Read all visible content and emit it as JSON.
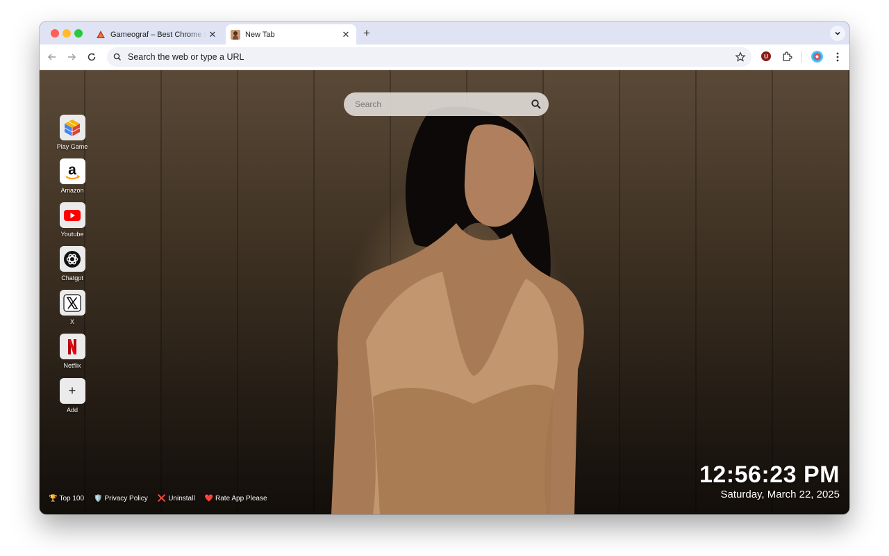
{
  "browser": {
    "tabs": [
      {
        "title": "Gameograf – Best Chrome Li…",
        "active": false,
        "favicon": "gameograf-logo-icon"
      },
      {
        "title": "New Tab",
        "active": true,
        "favicon": "portrait-favicon-icon"
      }
    ],
    "omnibox_placeholder": "Search the web or type a URL",
    "extensions": [
      {
        "name": "ublock-origin-icon",
        "glyph": "U",
        "color": "#8b1a1a"
      },
      {
        "name": "extensions-puzzle-icon"
      }
    ]
  },
  "newtab": {
    "search_placeholder": "Search",
    "shortcuts": [
      {
        "label": "Play Game",
        "icon": "cube-game-icon"
      },
      {
        "label": "Amazon",
        "icon": "amazon-icon"
      },
      {
        "label": "Youtube",
        "icon": "youtube-icon"
      },
      {
        "label": "Chatgpt",
        "icon": "chatgpt-icon"
      },
      {
        "label": "X",
        "icon": "x-logo-icon"
      },
      {
        "label": "Netflix",
        "icon": "netflix-icon"
      },
      {
        "label": "Add",
        "icon": "plus-icon"
      }
    ],
    "footer_links": [
      {
        "icon": "🏆",
        "label": "Top 100"
      },
      {
        "icon": "🛡️",
        "label": "Privacy Policy"
      },
      {
        "icon": "❌",
        "label": "Uninstall"
      },
      {
        "icon": "❤️",
        "label": "Rate App Please"
      }
    ],
    "clock": {
      "time": "12:56:23 PM",
      "date": "Saturday, March 22, 2025"
    }
  },
  "colors": {
    "tabstrip": "#dfe3f4",
    "youtube_red": "#ff0000",
    "netflix_red": "#e50914"
  }
}
